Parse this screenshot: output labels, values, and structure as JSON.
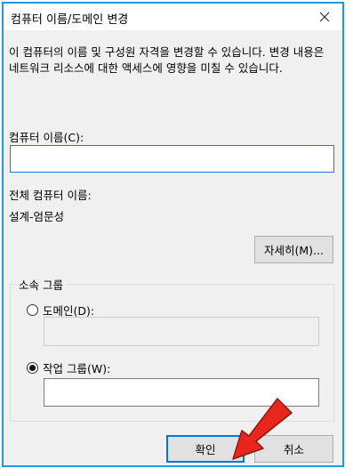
{
  "dialog": {
    "title": "컴퓨터 이름/도메인 변경",
    "description": "이 컴퓨터의 이름 및 구성원 자격을 변경할 수 있습니다. 변경 내용은 네트워크 리소스에 대한 액세스에 영향을 미칠 수 있습니다.",
    "computer_name_label": "컴퓨터 이름(C):",
    "computer_name_value": "",
    "full_name_label": "전체 컴퓨터 이름:",
    "full_name_value": "설계-엄문성",
    "more_button": "자세히(M)...",
    "membership_legend": "소속 그룹",
    "domain_radio_label": "도메인(D):",
    "domain_value": "",
    "domain_selected": false,
    "workgroup_radio_label": "작업 그룹(W):",
    "workgroup_value": "",
    "workgroup_selected": true,
    "ok_button": "확인",
    "cancel_button": "취소"
  },
  "colors": {
    "window_border": "#1e9ae0",
    "dialog_background": "#f0f0f0",
    "annotation_arrow": "#e8261c"
  },
  "icons": {
    "close": "close-icon",
    "annotation": "red-arrow-icon"
  }
}
